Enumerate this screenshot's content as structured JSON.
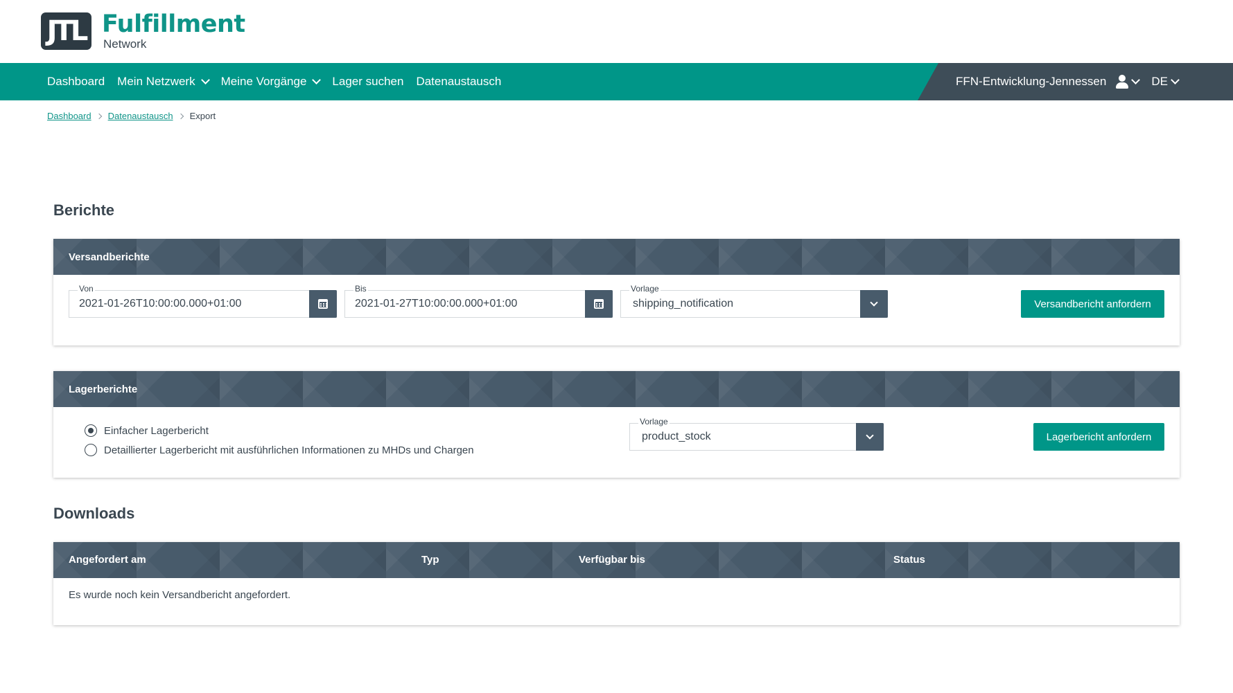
{
  "logo": {
    "mark": "JTL",
    "title": "Fulfillment",
    "subtitle": "Network"
  },
  "nav": {
    "items": [
      {
        "label": "Dashboard",
        "dropdown": false
      },
      {
        "label": "Mein Netzwerk",
        "dropdown": true
      },
      {
        "label": "Meine Vorgänge",
        "dropdown": true
      },
      {
        "label": "Lager suchen",
        "dropdown": false
      },
      {
        "label": "Datenaustausch",
        "dropdown": false
      }
    ],
    "account": "FFN-Entwicklung-Jennessen",
    "language": "DE"
  },
  "breadcrumb": {
    "items": [
      "Dashboard",
      "Datenaustausch"
    ],
    "current": "Export"
  },
  "reports": {
    "title": "Berichte",
    "shipping": {
      "title": "Versandberichte",
      "from_label": "Von",
      "from_value": "2021-01-26T10:00:00.000+01:00",
      "to_label": "Bis",
      "to_value": "2021-01-27T10:00:00.000+01:00",
      "template_label": "Vorlage",
      "template_value": "shipping_notification",
      "button": "Versandbericht anfordern"
    },
    "stock": {
      "title": "Lagerberichte",
      "options": [
        {
          "label": "Einfacher Lagerbericht",
          "selected": true
        },
        {
          "label": "Detaillierter Lagerbericht mit ausführlichen Informationen zu MHDs und Chargen",
          "selected": false
        }
      ],
      "template_label": "Vorlage",
      "template_value": "product_stock",
      "button": "Lagerbericht anfordern"
    }
  },
  "downloads": {
    "title": "Downloads",
    "columns": [
      "Angefordert am",
      "Typ",
      "Verfügbar bis",
      "Status"
    ],
    "empty": "Es wurde noch kein Versandbericht angefordert."
  },
  "colors": {
    "primary": "#009688",
    "dark": "#485b6b",
    "nav_dark": "#3e4d58",
    "text": "#3a4650"
  }
}
